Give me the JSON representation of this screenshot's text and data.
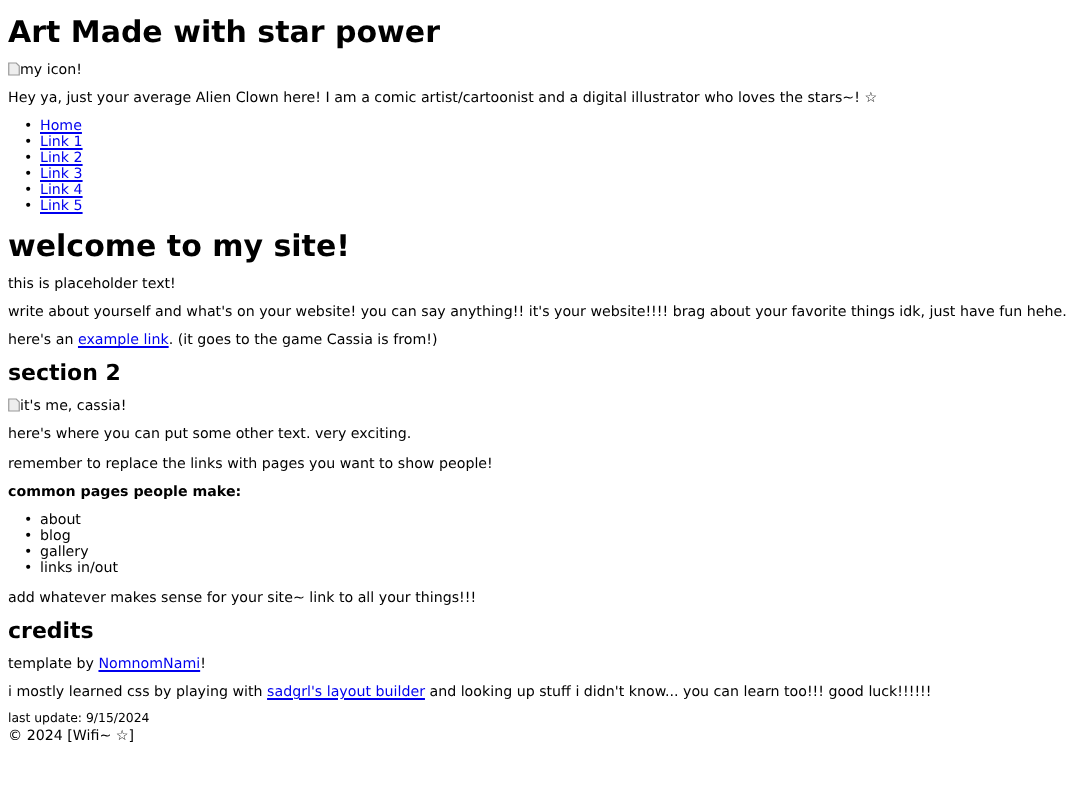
{
  "site_title": "Art Made with star power",
  "header_image": {
    "alt": "my icon!"
  },
  "intro": "Hey ya, just your average Alien Clown here! I am a comic artist/cartoonist and a digital illustrator who loves the stars~! ☆",
  "bullet": "•",
  "nav_links": [
    "Home",
    "Link 1",
    "Link 2",
    "Link 3",
    "Link 4",
    "Link 5"
  ],
  "sections": [
    {
      "heading": "welcome to my site!",
      "kind": "large",
      "blocks": [
        {
          "kind": "text",
          "text": "this is placeholder text!"
        },
        {
          "kind": "text",
          "text": "write about yourself and what's on your website! you can say anything!! it's your website!!!! brag about your favorite things idk, just have fun hehe."
        },
        {
          "kind": "link_text",
          "before": "here's an ",
          "link": "example link",
          "after": ". (it goes to the game Cassia is from!)"
        }
      ]
    },
    {
      "heading": "section 2",
      "kind": "small",
      "blocks": [
        {
          "kind": "image",
          "alt": "it's me, cassia!"
        },
        {
          "kind": "text",
          "text": "here's where you can put some other text. very exciting."
        },
        {
          "kind": "text",
          "text": "remember to replace the links with pages you want to show people!"
        },
        {
          "kind": "bold",
          "text": "common pages people make:"
        },
        {
          "kind": "list",
          "items": [
            "about",
            "blog",
            "gallery",
            "links in/out"
          ]
        },
        {
          "kind": "text",
          "text": "add whatever makes sense for your site~ link to all your things!!!"
        }
      ]
    },
    {
      "heading": "credits",
      "kind": "small",
      "blocks": [
        {
          "kind": "link_text",
          "before": "template by ",
          "link": "NomnomNami",
          "after": "!"
        },
        {
          "kind": "link_text",
          "before": "i mostly learned css by playing with ",
          "link": "sadgrl's layout builder",
          "after": " and looking up stuff i didn't know... you can learn too!!! good luck!!!!!!"
        }
      ]
    }
  ],
  "last_update": "last update: 9/15/2024",
  "copyright": "© 2024 [Wifi~ ☆]"
}
